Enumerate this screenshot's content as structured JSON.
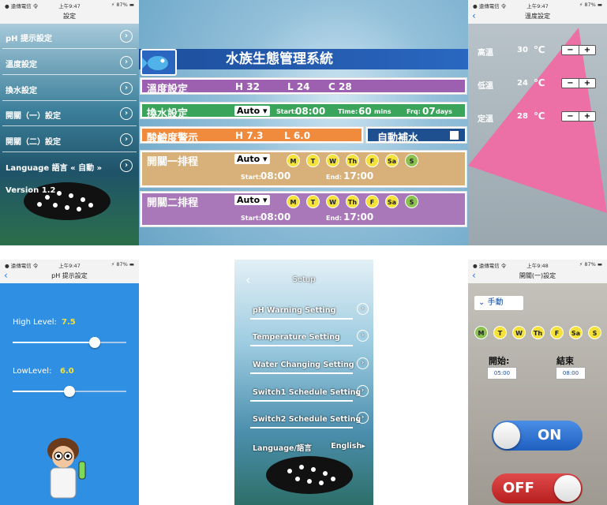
{
  "status": {
    "carrier": "● 遠傳電信 令",
    "time1": "上午9:47",
    "time2": "上午9:48",
    "battery": "⚡ 87% ▬"
  },
  "p1": {
    "title": "設定",
    "items": [
      {
        "label": "pH 提示設定"
      },
      {
        "label": "溫度設定"
      },
      {
        "label": "換水設定"
      },
      {
        "label": "開關（一）設定"
      },
      {
        "label": "開關（二）設定"
      },
      {
        "label": "Language 語言 « 自動 »"
      }
    ],
    "version": "Version 1.2"
  },
  "p2": {
    "title": "水族生態管理系統",
    "temp": {
      "label": "溫度設定",
      "h": "H 32",
      "l": "L 24",
      "c": "C 28"
    },
    "water": {
      "label": "換水設定",
      "mode": "Auto",
      "start_lbl": "Start:",
      "start": "08:00",
      "time_lbl": "Time:",
      "time": "60",
      "time_unit": "mins",
      "frq_lbl": "Frq:",
      "frq": "07",
      "frq_unit": "days"
    },
    "ph": {
      "label": "酸鹼度警示",
      "h": "H 7.3",
      "l": "L 6.0",
      "auto_fill": "自動補水"
    },
    "sw1": {
      "label": "開關一排程",
      "mode": "Auto",
      "start_lbl": "Start:",
      "start": "08:00",
      "end_lbl": "End:",
      "end": "17:00"
    },
    "sw2": {
      "label": "開關二排程",
      "mode": "Auto",
      "start_lbl": "Start:",
      "start": "08:00",
      "end_lbl": "End:",
      "end": "17:00"
    },
    "days": [
      "M",
      "T",
      "W",
      "Th",
      "F",
      "Sa",
      "S"
    ]
  },
  "p3": {
    "title": "溫度設定",
    "rows": [
      {
        "label": "高溫",
        "value": "30",
        "unit": "℃"
      },
      {
        "label": "低溫",
        "value": "24",
        "unit": "℃"
      },
      {
        "label": "定溫",
        "value": "28",
        "unit": "℃"
      }
    ],
    "minus": "−",
    "plus": "+"
  },
  "p4": {
    "title": "pH 提示設定",
    "high_label": "High Level:",
    "high": "7.5",
    "high_frac": 0.72,
    "low_label": "LowLevel:",
    "low": "6.0",
    "low_frac": 0.5
  },
  "p5": {
    "title": "Setup",
    "items": [
      {
        "label": "pH Warning Setting"
      },
      {
        "label": "Temperature Setting"
      },
      {
        "label": "Water Changing Setting"
      },
      {
        "label": "Switch1 Schedule Setting"
      },
      {
        "label": "Switch2 Schedule Setting"
      }
    ],
    "language_label": "Language/語言",
    "language": "English▸"
  },
  "p6": {
    "title": "開關(一)設定",
    "mode": "手動",
    "days": [
      "M",
      "T",
      "W",
      "Th",
      "F",
      "Sa",
      "S"
    ],
    "start_label": "開始:",
    "start": "05:00",
    "end_label": "結束",
    "end": "08:00",
    "on": "ON",
    "off": "OFF"
  },
  "colors": {
    "purple": "#9d5fb0",
    "green": "#3aa55a",
    "orange": "#f08a3c",
    "navy": "#1e4f8f",
    "tan": "#d8b07a",
    "lavender": "#a978b8",
    "pink": "#ec6fa6",
    "blue": "#2f8fe3",
    "yellow": "#f4e13a"
  }
}
